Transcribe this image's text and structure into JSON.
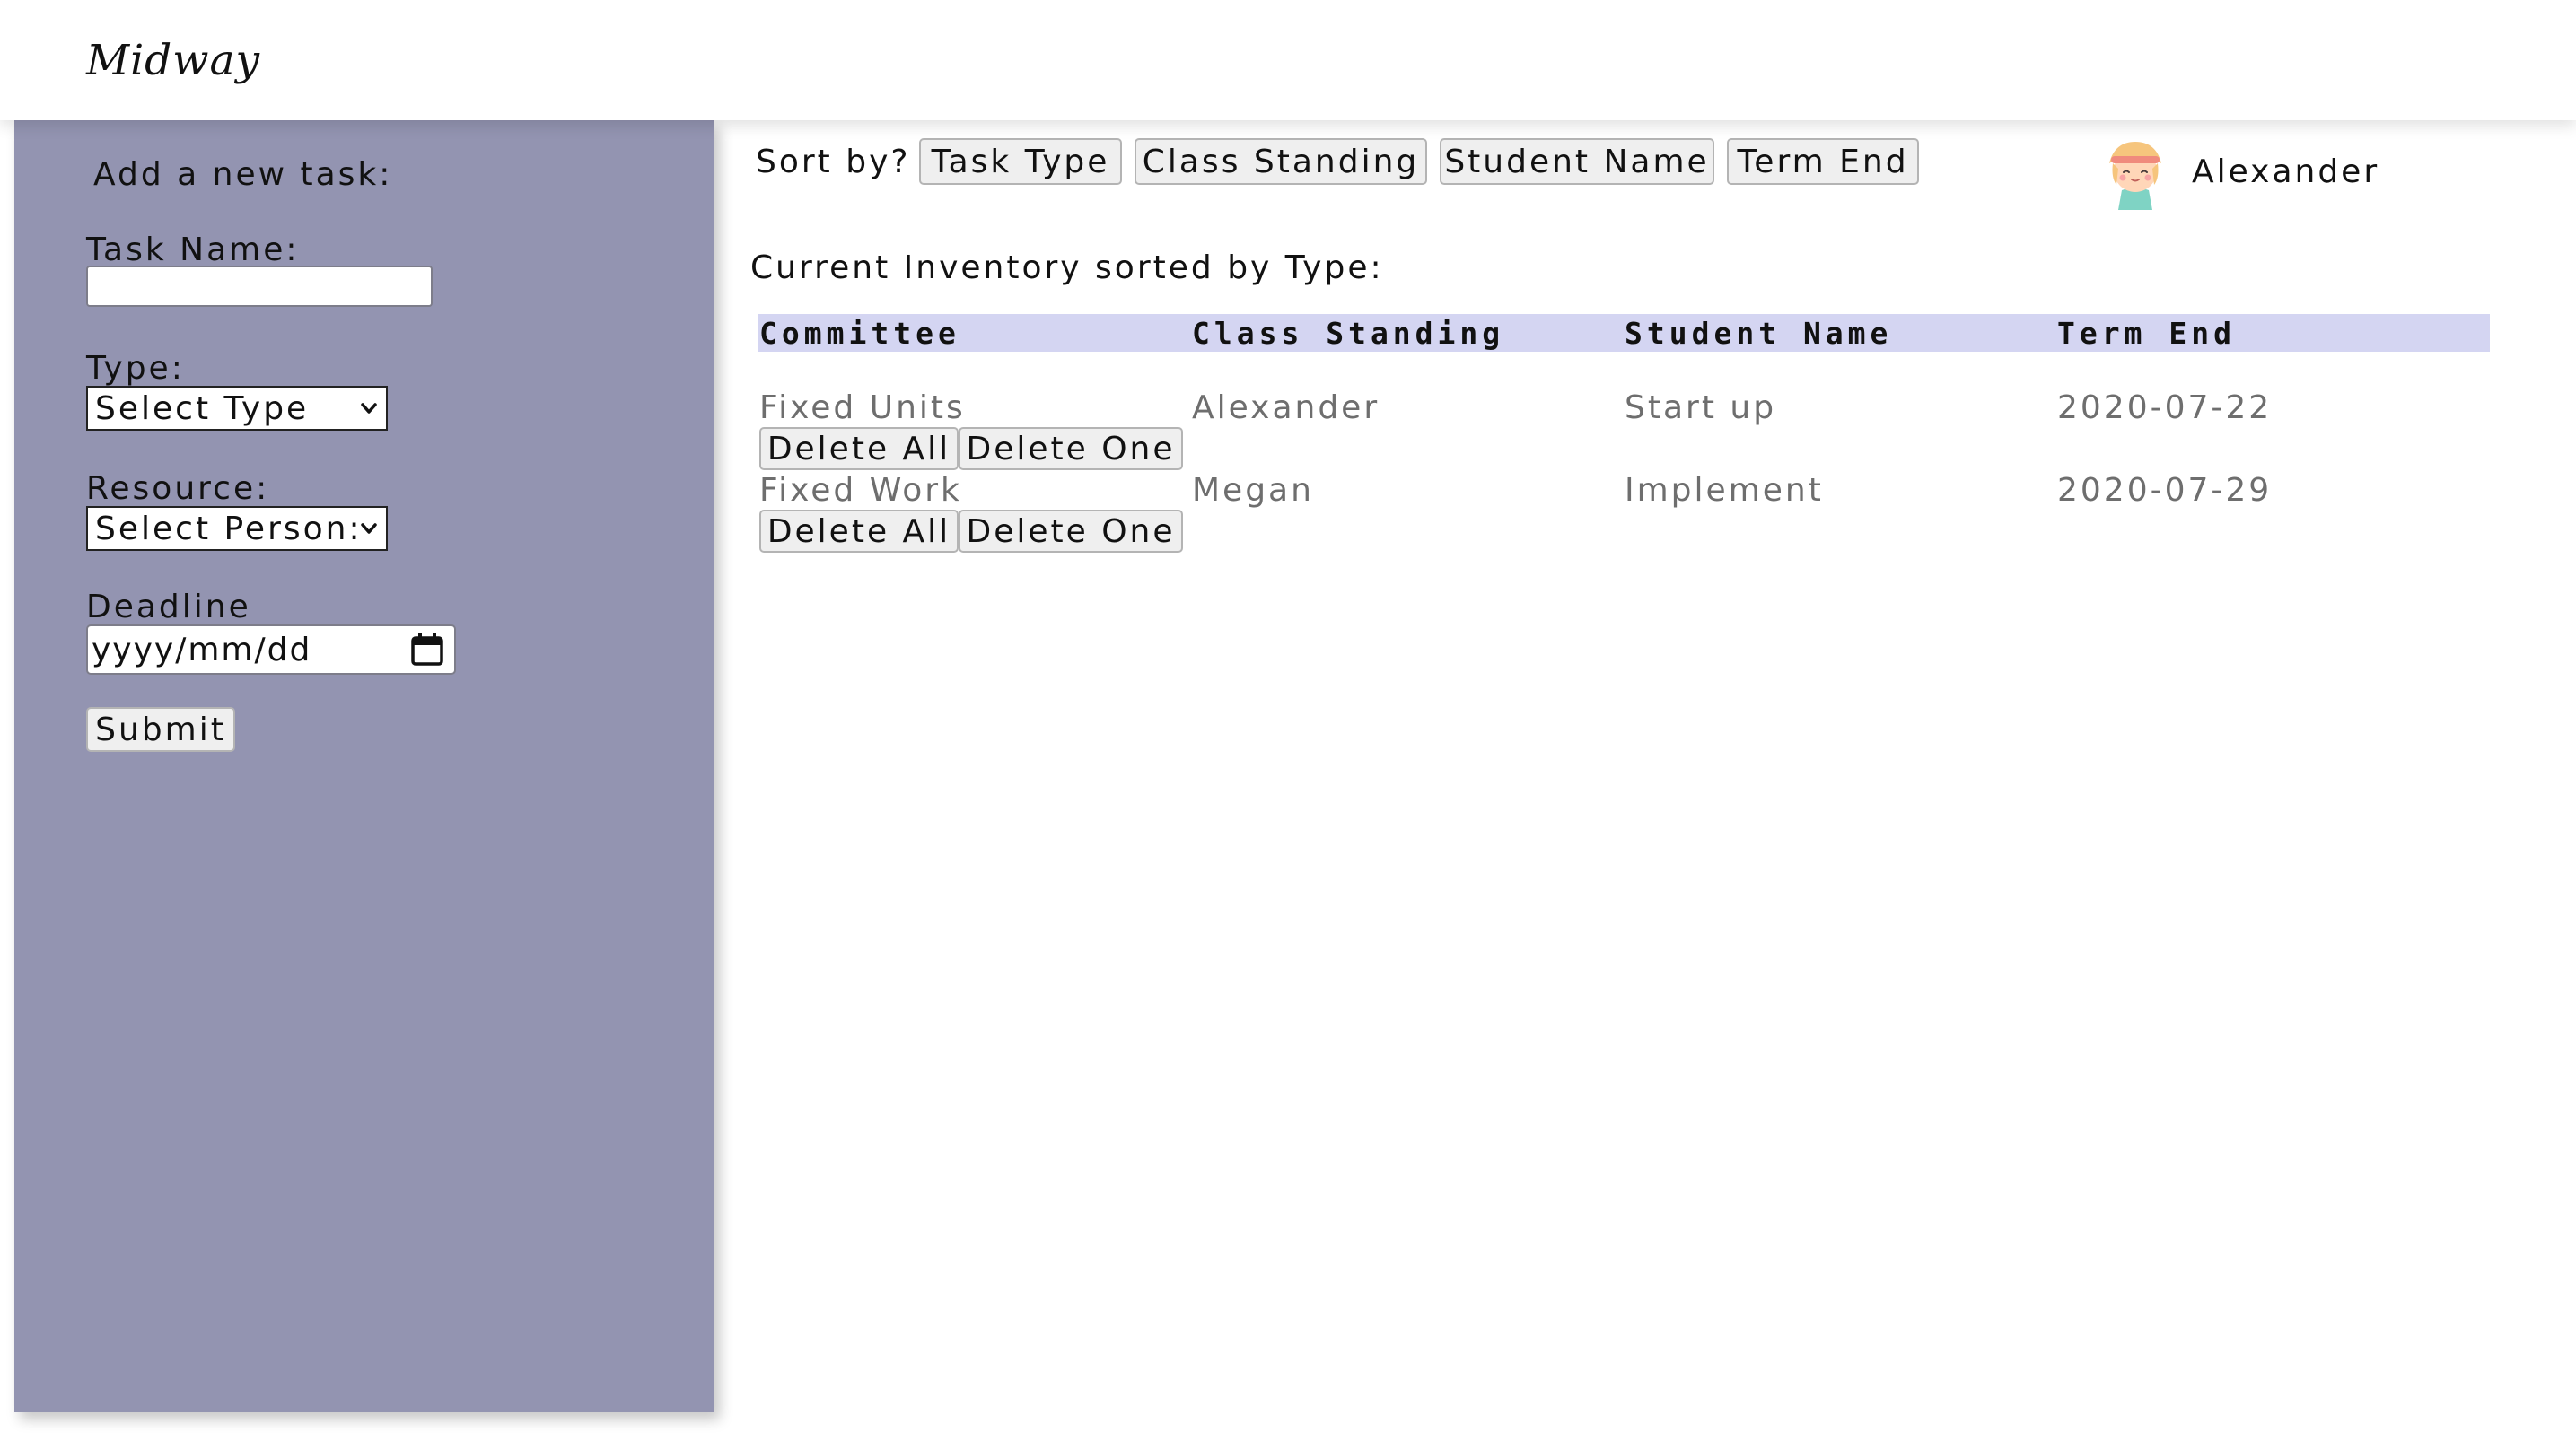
{
  "app": {
    "logo": "Midway"
  },
  "sidebar": {
    "form_title": "Add a new task:",
    "task_name_label": "Task Name:",
    "task_name_value": "",
    "type_label": "Type:",
    "type_selected": "Select Type",
    "resource_label": "Resource:",
    "resource_selected": "Select Person:",
    "deadline_label": "Deadline",
    "deadline_placeholder": "yyyy/mm/dd",
    "submit_label": "Submit"
  },
  "sort": {
    "label": "Sort by?",
    "buttons": [
      "Task Type",
      "Class Standing",
      "Student Name",
      "Term End"
    ]
  },
  "user": {
    "name": "Alexander"
  },
  "inventory": {
    "heading": "Current Inventory sorted by Type:",
    "columns": [
      "Committee",
      "Class Standing",
      "Student Name",
      "Term End"
    ],
    "rows": [
      {
        "cells": [
          "Fixed Units",
          "Alexander",
          "Start up",
          "2020-07-22"
        ],
        "delete_all_label": "Delete All",
        "delete_one_label": "Delete One"
      },
      {
        "cells": [
          "Fixed Work",
          "Megan",
          "Implement",
          "2020-07-29"
        ],
        "delete_all_label": "Delete All",
        "delete_one_label": "Delete One"
      }
    ]
  },
  "icons": {
    "type_dropdown": "chevron-down-icon",
    "resource_dropdown": "chevron-down-icon",
    "deadline": "calendar-icon",
    "user": "avatar"
  },
  "colors": {
    "sidebar_bg": "#9394b1",
    "table_header_bg": "#d4d5f2",
    "button_bg": "#efefef",
    "muted_text": "#6e6e6e"
  }
}
